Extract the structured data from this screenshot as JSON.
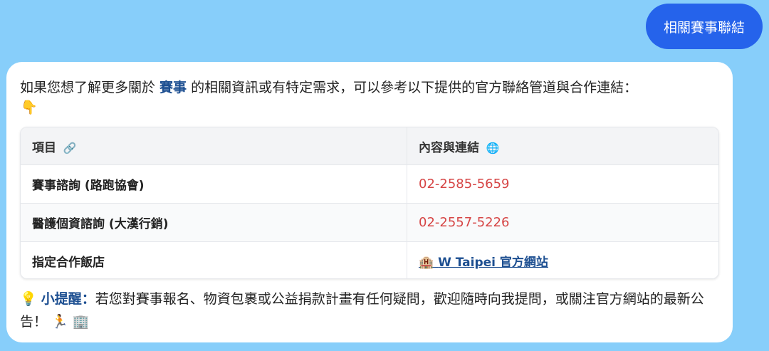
{
  "user_message": "相關賽事聯結",
  "bot": {
    "intro_before": "如果您想了解更多關於 ",
    "intro_keyword": "賽事",
    "intro_after": " 的相關資訊或有特定需求，可以參考以下提供的官方聯絡管道與合作連結：",
    "intro_emoji": "👇",
    "table": {
      "headers": [
        {
          "label": "項目",
          "icon": "🔗"
        },
        {
          "label": "內容與連結",
          "icon": "🌐"
        }
      ],
      "rows": [
        {
          "item": "賽事諮詢 (路跑協會)",
          "value": "02-2585-5659"
        },
        {
          "item": "醫護個資諮詢 (大漢行銷)",
          "value": "02-2557-5226"
        },
        {
          "item": "指定合作飯店",
          "link_icon": "🏨",
          "link_text": "W Taipei 官方網站"
        }
      ]
    },
    "tip": {
      "icon": "💡",
      "label": "小提醒：",
      "text": "若您對賽事報名、物資包裹或公益捐款計畫有任何疑問，歡迎隨時向我提問，或關注官方網站的最新公告！",
      "trailing_emojis": "🏃 🏢"
    }
  },
  "colors": {
    "background": "#87cefa",
    "user_bubble": "#2563eb",
    "keyword": "#1d4f91",
    "phone": "#d64545"
  }
}
